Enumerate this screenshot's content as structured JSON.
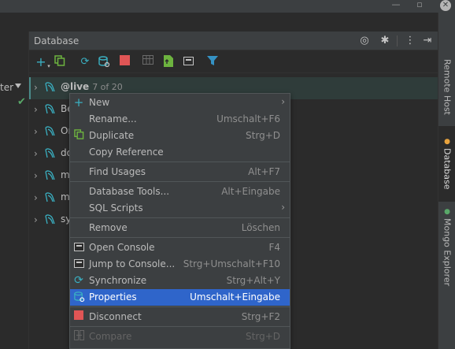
{
  "left": {
    "label": "ter"
  },
  "panel": {
    "title": "Database"
  },
  "tree": {
    "items": [
      {
        "name": "@live",
        "count": "7 of 20",
        "selected": true
      },
      {
        "name": "Be"
      },
      {
        "name": "Or"
      },
      {
        "name": "do"
      },
      {
        "name": "m"
      },
      {
        "name": "m"
      },
      {
        "name": "sy"
      }
    ]
  },
  "right_tabs": [
    {
      "label": "Remote Host"
    },
    {
      "label": "Database"
    },
    {
      "label": "Mongo Explorer"
    }
  ],
  "menu": {
    "items": [
      {
        "label": "New",
        "shortcut": "",
        "icon": "plus-icon"
      },
      {
        "label": "Rename...",
        "shortcut": "Umschalt+F6"
      },
      {
        "label": "Duplicate",
        "shortcut": "Strg+D",
        "icon": "copy-icon"
      },
      {
        "label": "Copy Reference",
        "shortcut": ""
      },
      {
        "label": "Find Usages",
        "shortcut": "Alt+F7"
      },
      {
        "label": "Database Tools...",
        "shortcut": "Alt+Eingabe"
      },
      {
        "label": "SQL Scripts",
        "shortcut": ""
      },
      {
        "label": "Remove",
        "shortcut": "Löschen"
      },
      {
        "label": "Open Console",
        "shortcut": "F4",
        "icon": "console-icon"
      },
      {
        "label": "Jump to Console...",
        "shortcut": "Strg+Umschalt+F10",
        "icon": "console-icon"
      },
      {
        "label": "Synchronize",
        "shortcut": "Strg+Alt+Y",
        "icon": "sync-icon"
      },
      {
        "label": "Properties",
        "shortcut": "Umschalt+Eingabe",
        "icon": "properties-icon"
      },
      {
        "label": "Disconnect",
        "shortcut": "Strg+F2",
        "icon": "stop-icon"
      },
      {
        "label": "Compare",
        "shortcut": "Strg+D",
        "icon": "compare-icon"
      }
    ]
  },
  "colors": {
    "accent_highlight": "#2f65ca",
    "stop_red": "#e05555",
    "filter_blue": "#3592c4",
    "sync_teal": "#3ab0c2",
    "check_green": "#59a869"
  }
}
